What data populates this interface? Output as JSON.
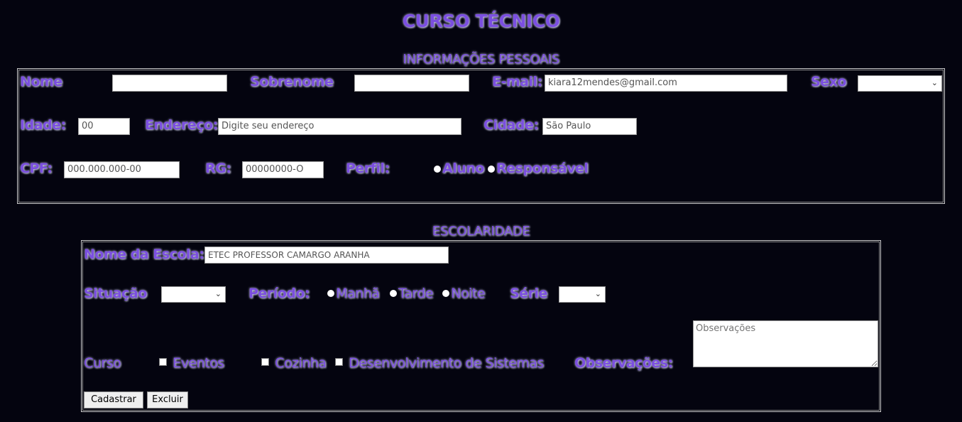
{
  "page": {
    "title": "CURSO TÉCNICO"
  },
  "personal": {
    "section_title": "INFORMAÇÕES PESSOAIS",
    "nome_label": "Nome",
    "nome_value": "",
    "sobrenome_label": "Sobrenome",
    "sobrenome_value": "",
    "email_label": "E-mail:",
    "email_value": "kiara12mendes@gmail.com",
    "sexo_label": "Sexo",
    "sexo_value": "",
    "idade_label": "Idade:",
    "idade_value": "00",
    "endereco_label": "Endereço:",
    "endereco_placeholder": "Digite seu endereço",
    "cidade_label": "Cidade:",
    "cidade_value": "São Paulo",
    "cpf_label": "CPF:",
    "cpf_placeholder": "000.000.000-00",
    "rg_label": "RG:",
    "rg_placeholder": "00000000-O",
    "perfil_label": "Perfil:",
    "perfil_options": [
      "Aluno",
      "Responsável"
    ]
  },
  "school": {
    "section_title": "ESCOLARIDADE",
    "escola_label": "Nome da Escola:",
    "escola_value": "ETEC PROFESSOR CAMARGO ARANHA",
    "situacao_label": "Situação",
    "situacao_value": "",
    "periodo_label": "Período:",
    "periodo_options": [
      "Manhã",
      "Tarde",
      "Noite"
    ],
    "serie_label": "Série",
    "serie_value": "",
    "curso_label": "Curso",
    "curso_options": [
      "Eventos",
      "Cozinha",
      "Desenvolvimento de Sistemas"
    ],
    "observacoes_label": "Observações:",
    "observacoes_placeholder": "Observações"
  },
  "buttons": {
    "cadastrar": "Cadastrar",
    "excluir": "Excluir"
  },
  "colors": {
    "background": "#04040f",
    "label_purple": "#7b4fe0"
  }
}
